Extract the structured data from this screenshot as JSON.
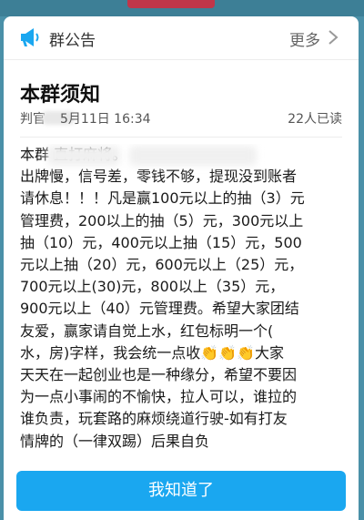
{
  "header": {
    "title": "群公告",
    "more_label": "更多"
  },
  "notice": {
    "title": "本群须知",
    "author": "判官",
    "time": "5月11日 16:34",
    "read_count": "22人已读",
    "lines": [
      "本群              直打麻将。",
      "出牌慢，信号差，零钱不够，提现没到账者",
      "请休息！！！凡是赢100元以上的抽（3）元",
      "管理费，200以上的抽（5）元，300元以上",
      "抽（10）元，400元以上抽（15）元，500",
      "元以上抽（20）元，600元以上（25）元，",
      "700元以上(30)元，800以上（35）元，",
      "900元以上（40）元管理费。希望大家团结",
      "友爱，赢家请自觉上水，红包标明一个(",
      "水，房)字样，我会统一点收👏👏👏大家",
      "天天在一起创业也是一种缘分，希望不要因",
      "为一点小事闹的不愉快，拉人可以，谁拉的",
      "谁负责，玩套路的麻烦绕道行驶-如有打友",
      "情牌的（一律双踢）后果自负"
    ]
  },
  "confirm_button": "我知道了",
  "colors": {
    "accent": "#1aa7f0",
    "backdrop": "#4a90a8"
  },
  "icons": {
    "header": "megaphone-icon",
    "more": "chevron-right-icon"
  }
}
